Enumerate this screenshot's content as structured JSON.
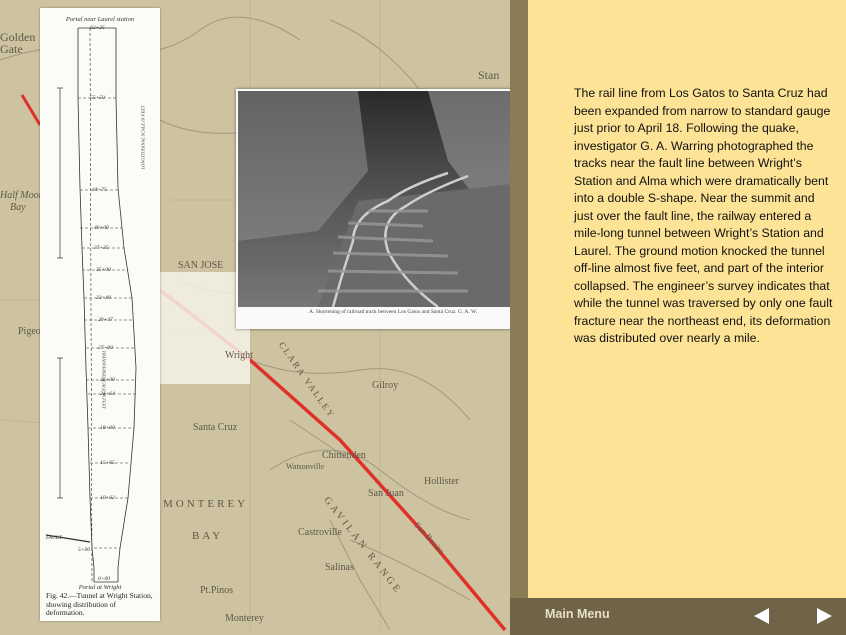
{
  "map": {
    "labels": [
      "Golden",
      "Gate",
      "Stan",
      "Half Moon",
      "Bay",
      "Pigeo",
      "SAN JOSE",
      "Wright",
      "CLARA VALLEY",
      "Gilroy",
      "Santa Cruz",
      "Chittenden",
      "Watsonville",
      "Hollister",
      "San Juan",
      "MONTEREY",
      "BAY",
      "Castroville",
      "Salinas",
      "Pt.Pinos",
      "Monterey",
      "GAVILAN RANGE",
      "San Benito"
    ]
  },
  "diagram": {
    "top_label": "Portal near Laurel station",
    "bottom_label": "Portal at Wright",
    "fault_label": "FAULT",
    "long_scale_label": "LONGITUDINAL SCALE IN FEET",
    "trans_scale_label": "TRANSVERSE SCALE IN FEET",
    "stations": [
      "62+25",
      "55+50",
      "44+75",
      "40+00",
      "37+35",
      "35+00",
      "32+40",
      "29+47",
      "27+00",
      "25+00",
      "21+64",
      "18+00",
      "15+65",
      "10+62",
      "5+00",
      "0+00"
    ],
    "caption": "Fig. 42.—Tunnel at Wright Station, showing distribution of deformation."
  },
  "photo": {
    "caption": "A. Shortening of railroad track between Los Gatos and Santa Cruz. G. A. W."
  },
  "body_text": "The rail line from Los Gatos to Santa Cruz had been expanded from narrow to standard gauge just prior to April 18. Following the quake, investigator G. A. Warring photographed the tracks near the fault line between Wright’s Station and Alma which were dramatically bent into a double S-shape. Near the summit and just over the fault line, the railway entered a mile-long tunnel between Wright’s Station and Laurel. The ground motion knocked the tunnel off-line almost five feet, and part of the interior collapsed. The engineer’s survey indicates that while the tunnel was traversed by only one fault fracture near the northeast end, its deformation was distributed over nearly a mile.",
  "footer": {
    "menu_label": "Main Menu",
    "prev_icon": "left-arrow-icon",
    "next_icon": "right-arrow-icon"
  },
  "colors": {
    "panel": "#fde395",
    "fault_line": "#e0302a",
    "footer": "#6f6448"
  }
}
